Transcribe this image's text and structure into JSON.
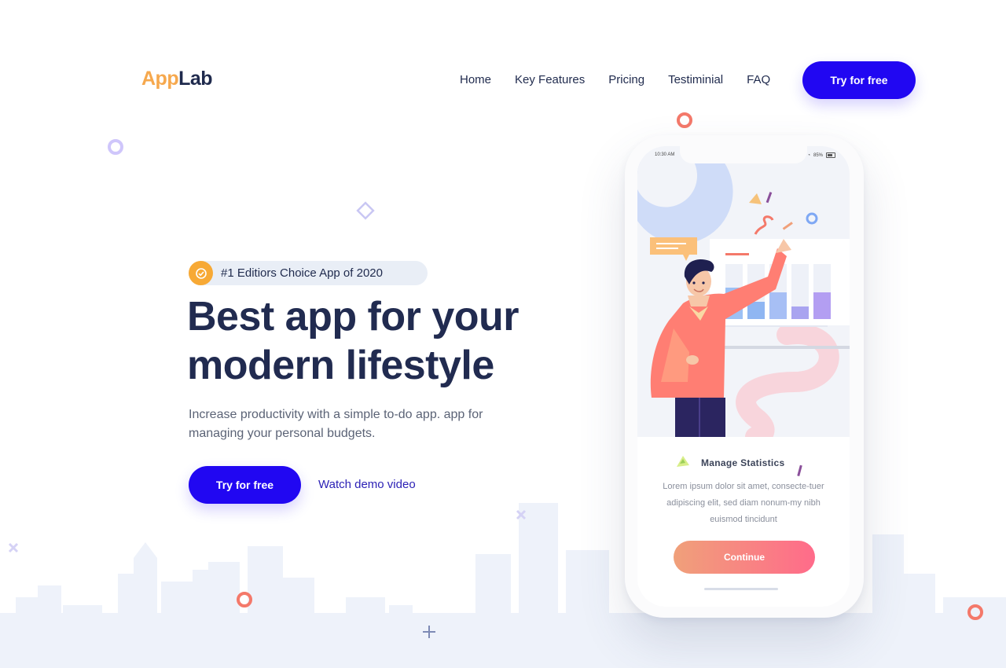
{
  "header": {
    "logo_part1": "App",
    "logo_part2": "Lab",
    "nav": [
      "Home",
      "Key Features",
      "Pricing",
      "Testiminial",
      "FAQ"
    ],
    "cta_label": "Try for free"
  },
  "hero": {
    "badge_text": "#1 Editiors Choice App of 2020",
    "headline_line1": "Best app for your",
    "headline_line2": "modern lifestyle",
    "subtitle": "Increase productivity with a simple to-do app. app for managing your personal budgets.",
    "primary_button": "Try for free",
    "secondary_link": "Watch demo video"
  },
  "phone": {
    "status_time": "10:30 AM",
    "status_battery": "85%",
    "card_title": "Manage Statistics",
    "card_body": "Lorem ipsum dolor sit amet, consecte-tuer adipiscing elit, sed diam nonum-my nibh euismod tincidunt",
    "continue_label": "Continue"
  },
  "colors": {
    "brand_orange": "#f6a84d",
    "primary_blue": "#2107f2",
    "heading_navy": "#212b50",
    "badge_orange": "#f7a935",
    "accent_coral": "#f4796a"
  },
  "icons": [
    "check-badge-icon",
    "ring-icon",
    "diamond-icon",
    "cross-icon",
    "plus-icon"
  ]
}
